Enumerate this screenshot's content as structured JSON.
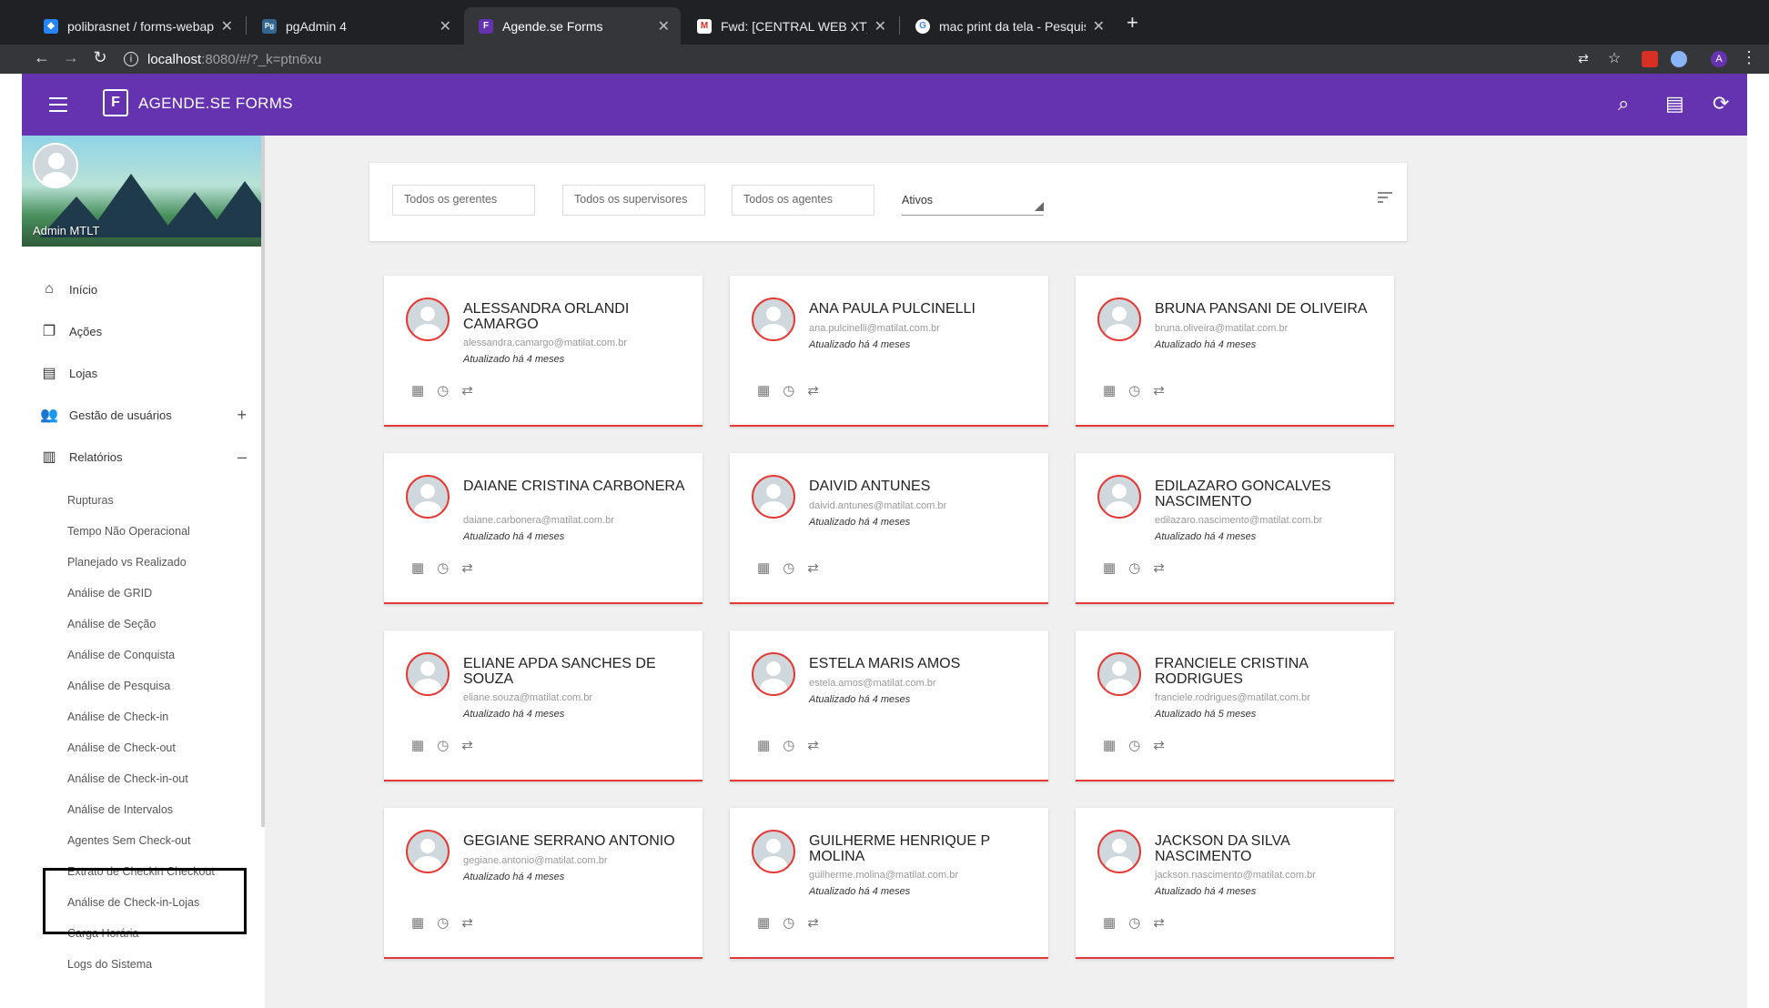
{
  "browser": {
    "tabs": [
      {
        "title": "polibrasnet / forms-webapp —",
        "favicon": "bitbucket-icon",
        "color": "#2684ff",
        "glyph": "◆"
      },
      {
        "title": "pgAdmin 4",
        "favicon": "pgadmin-icon",
        "color": "#336791",
        "glyph": "Pg"
      },
      {
        "title": "Agende.se Forms",
        "favicon": "app-icon",
        "color": "#6633b0",
        "glyph": "F"
      },
      {
        "title": "Fwd: [CENTRAL WEB XT] - No",
        "favicon": "gmail-icon",
        "color": "#d93025",
        "glyph": "M"
      },
      {
        "title": "mac print da tela - Pesquisa Go",
        "favicon": "google-icon",
        "color": "#4285f4",
        "glyph": "G"
      }
    ],
    "url_host": "localhost",
    "url_path": ":8080/#/?_k=ptn6xu",
    "profile_initial": "A"
  },
  "app": {
    "name": "AGENDE.SE FORMS",
    "logo_letter": "F",
    "accent": "#6633b0",
    "card_accent": "#e53935"
  },
  "sidebar": {
    "user": "Admin MTLT",
    "items": [
      {
        "label": "Início",
        "icon": "home-icon",
        "glyph": "⌂"
      },
      {
        "label": "Ações",
        "icon": "copy-icon",
        "glyph": "❐"
      },
      {
        "label": "Lojas",
        "icon": "store-icon",
        "glyph": "▤"
      },
      {
        "label": "Gestão de usuários",
        "icon": "people-icon",
        "glyph": "👥",
        "toggle": "+"
      },
      {
        "label": "Relatórios",
        "icon": "report-icon",
        "glyph": "▥",
        "toggle": "–"
      }
    ],
    "sub_items": [
      "Rupturas",
      "Tempo Não Operacional",
      "Planejado vs Realizado",
      "Análise de GRID",
      "Análise de Seção",
      "Análise de Conquista",
      "Análise de Pesquisa",
      "Análise de Check-in",
      "Análise de Check-out",
      "Análise de Check-in-out",
      "Análise de Intervalos",
      "Agentes Sem Check-out",
      "Extrato de Checkin Checkout",
      "Análise de Check-in-Lojas",
      "Carga Horária",
      "Logs do Sistema"
    ]
  },
  "filters": {
    "managers": "Todos os gerentes",
    "supervisors": "Todos os supervisores",
    "agents": "Todos os agentes",
    "status": "Ativos"
  },
  "cards": [
    {
      "name": "ALESSANDRA ORLANDI CAMARGO",
      "email": "alessandra.camargo@matilat.com.br",
      "updated": "Atualizado há 4 meses",
      "lines": 2
    },
    {
      "name": "ANA PAULA PULCINELLI",
      "email": "ana.pulcinelli@matilat.com.br",
      "updated": "Atualizado há 4 meses",
      "lines": 1
    },
    {
      "name": "BRUNA PANSANI DE OLIVEIRA",
      "email": "bruna.oliveira@matilat.com.br",
      "updated": "Atualizado há 4 meses",
      "lines": 1
    },
    {
      "name": "DAIANE CRISTINA CARBONERA",
      "email": "daiane.carbonera@matilat.com.br",
      "updated": "Atualizado há 4 meses",
      "lines": 2
    },
    {
      "name": "DAIVID ANTUNES",
      "email": "daivid.antunes@matilat.com.br",
      "updated": "Atualizado há 4 meses",
      "lines": 1
    },
    {
      "name": "EDILAZARO GONCALVES NASCIMENTO",
      "email": "edilazaro.nascimento@matilat.com.br",
      "updated": "Atualizado há 4 meses",
      "lines": 2
    },
    {
      "name": "ELIANE APDA SANCHES DE SOUZA",
      "email": "eliane.souza@matilat.com.br",
      "updated": "Atualizado há 4 meses",
      "lines": 2
    },
    {
      "name": "ESTELA MARIS AMOS",
      "email": "estela.amos@matilat.com.br",
      "updated": "Atualizado há 4 meses",
      "lines": 1
    },
    {
      "name": "FRANCIELE CRISTINA RODRIGUES",
      "email": "franciele.rodrigues@matilat.com.br",
      "updated": "Atualizado há 5 meses",
      "lines": 2
    },
    {
      "name": "GEGIANE SERRANO ANTONIO",
      "email": "gegiane.antonio@matilat.com.br",
      "updated": "Atualizado há 4 meses",
      "lines": 1
    },
    {
      "name": "GUILHERME HENRIQUE P MOLINA",
      "email": "guilherme.molina@matilat.com.br",
      "updated": "Atualizado há 4 meses",
      "lines": 2
    },
    {
      "name": "JACKSON DA SILVA NASCIMENTO",
      "email": "jackson.nascimento@matilat.com.br",
      "updated": "Atualizado há 4 meses",
      "lines": 2
    }
  ]
}
